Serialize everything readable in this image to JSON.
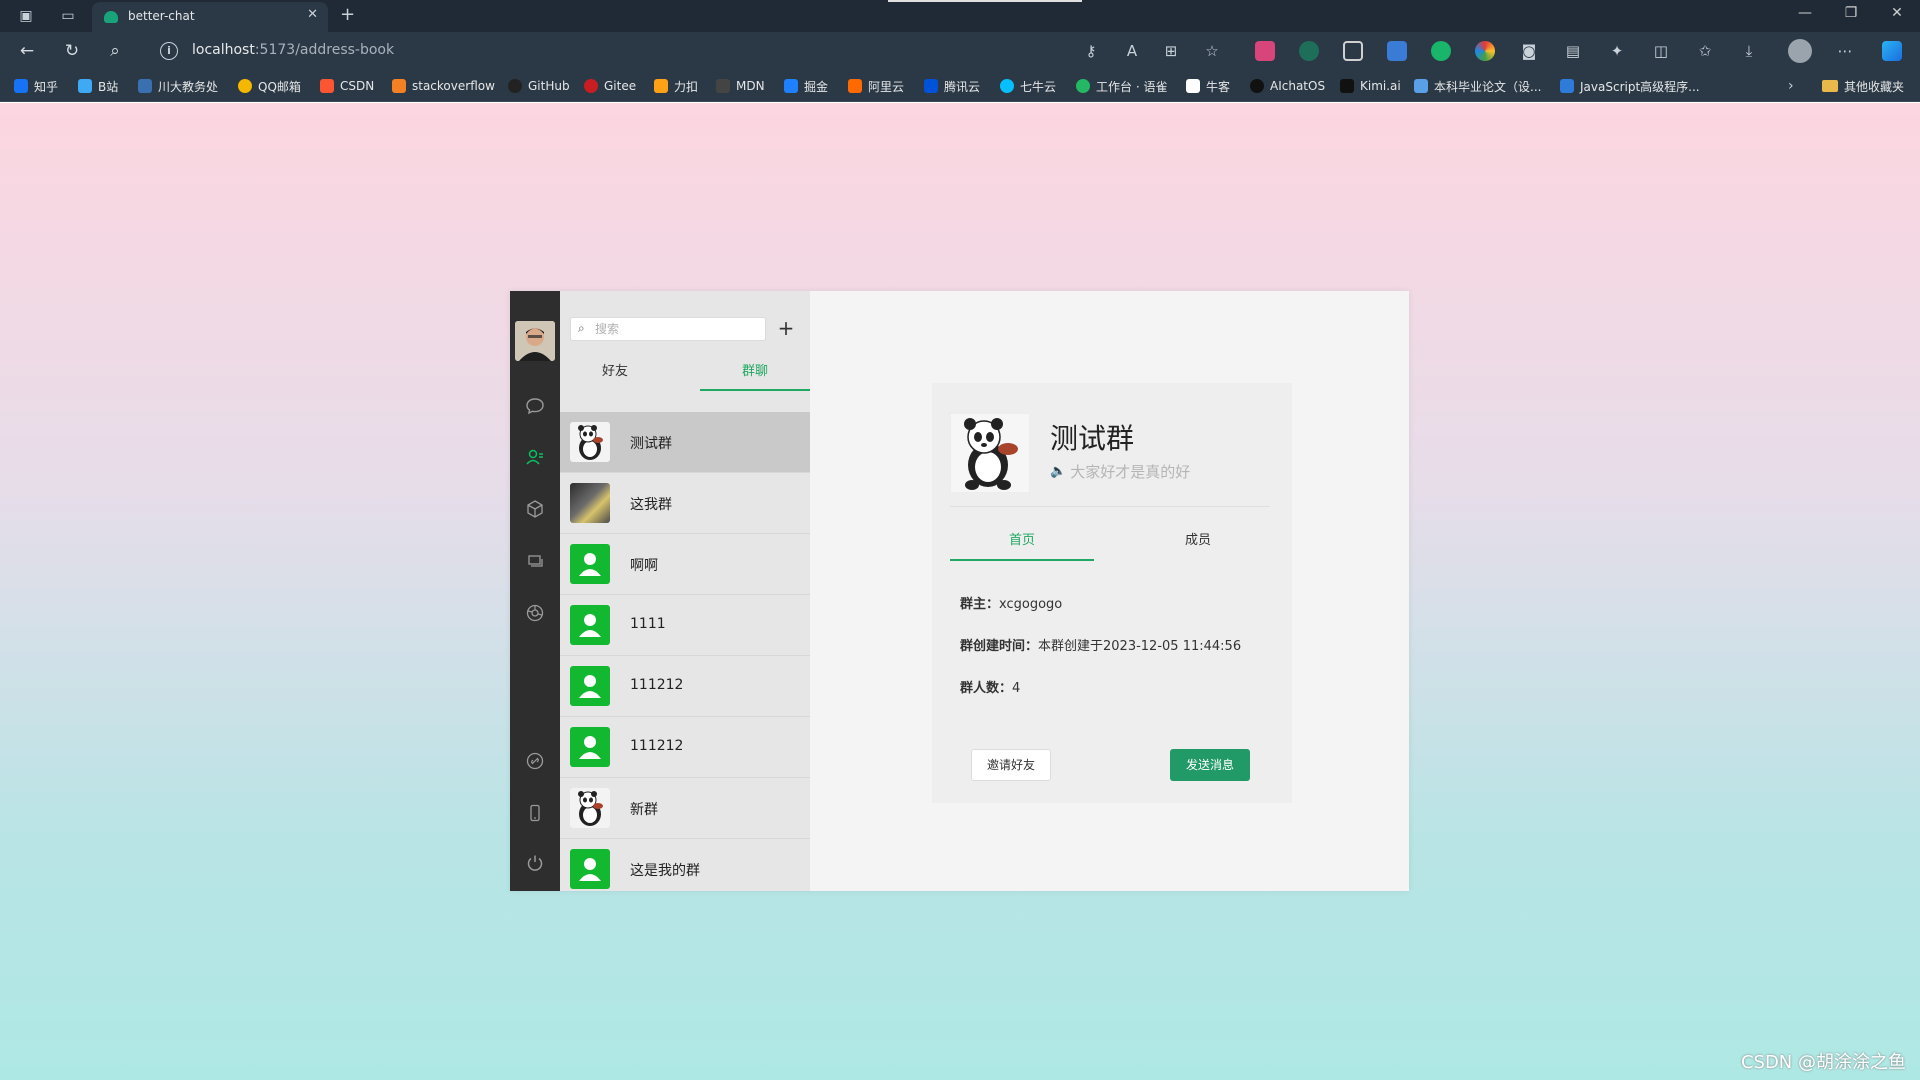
{
  "browser": {
    "tab_title": "better-chat",
    "url_host": "localhost",
    "url_path": ":5173/address-book",
    "new_tab_symbol": "+",
    "bookmarks": [
      {
        "label": "知乎",
        "color": "#1772f6"
      },
      {
        "label": "B站",
        "color": "#3fa9f5"
      },
      {
        "label": "川大教务处",
        "color": "#3a6fb0"
      },
      {
        "label": "QQ邮箱",
        "color": "#f5b800"
      },
      {
        "label": "CSDN",
        "color": "#fc5531"
      },
      {
        "label": "stackoverflow",
        "color": "#f48024"
      },
      {
        "label": "GitHub",
        "color": "#222222"
      },
      {
        "label": "Gitee",
        "color": "#c71d23"
      },
      {
        "label": "力扣",
        "color": "#ffa116"
      },
      {
        "label": "MDN",
        "color": "#222222"
      },
      {
        "label": "掘金",
        "color": "#1e80ff"
      },
      {
        "label": "阿里云",
        "color": "#ff6a00"
      },
      {
        "label": "腾讯云",
        "color": "#0052d9"
      },
      {
        "label": "七牛云",
        "color": "#07beff"
      },
      {
        "label": "工作台 · 语雀",
        "color": "#25b864"
      },
      {
        "label": "牛客",
        "color": "#ffffff"
      },
      {
        "label": "AIchatOS",
        "color": "#222222"
      },
      {
        "label": "Kimi.ai",
        "color": "#111111"
      },
      {
        "label": "本科毕业论文（设...",
        "color": "#5aa0e6"
      },
      {
        "label": "JavaScript高级程序...",
        "color": "#2f7bd9"
      }
    ],
    "other_bookmarks": "其他收藏夹"
  },
  "app": {
    "search": {
      "placeholder": "搜索"
    },
    "add_symbol": "+",
    "tabs": {
      "friends": "好友",
      "groups": "群聊"
    },
    "groups": [
      {
        "name": "测试群",
        "avatar": "panda"
      },
      {
        "name": "这我群",
        "avatar": "photo"
      },
      {
        "name": "啊啊",
        "avatar": "default"
      },
      {
        "name": "1111",
        "avatar": "default"
      },
      {
        "name": "111212",
        "avatar": "default"
      },
      {
        "name": "111212",
        "avatar": "default"
      },
      {
        "name": "新群",
        "avatar": "panda"
      },
      {
        "name": "这是我的群",
        "avatar": "default"
      }
    ],
    "detail": {
      "name": "测试群",
      "notice": "大家好才是真的好",
      "tabs": {
        "home": "首页",
        "members": "成员"
      },
      "owner_label": "群主：",
      "owner_value": "xcgogogo",
      "created_label": "群创建时间：",
      "created_value": "本群创建于2023-12-05 11:44:56",
      "count_label": "群人数：",
      "count_value": "4",
      "invite_button": "邀请好友",
      "send_button": "发送消息"
    }
  },
  "watermark": "CSDN @胡涂涂之鱼",
  "colors": {
    "accent": "#1ea862",
    "send_button": "#229a67",
    "default_avatar": "#12b82f"
  }
}
